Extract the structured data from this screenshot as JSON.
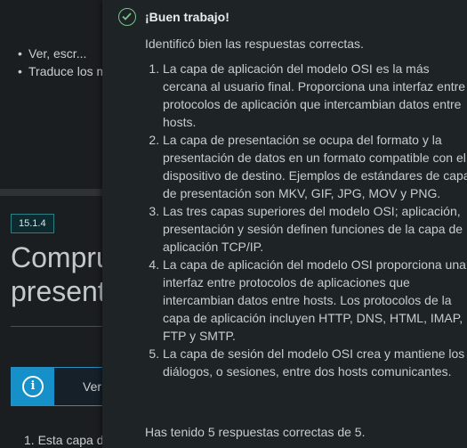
{
  "background": {
    "bullets": [
      "Ver, escr...",
      "Traduce los m"
    ],
    "section_badge": "15.1.4",
    "section_title_line1": "Compru",
    "section_title_line2": "present",
    "infobox_label": "Ver",
    "list_first_item": "1. Esta capa d"
  },
  "feedback": {
    "heading": "¡Buen trabajo!",
    "intro": "Identificó bien las respuestas correctas.",
    "answers": [
      "La capa de aplicación del modelo OSI es la más cercana al usuario final. Proporciona una interfaz entre protocolos de aplicación que intercambian datos entre hosts.",
      "La capa de presentación se ocupa del formato y la presentación de datos en un formato compatible con el dispositivo de destino. Ejemplos de estándares de capa de presentación son MKV, GIF, JPG, MOV y PNG.",
      "Las tres capas superiores del modelo OSI; aplicación, presentación y sesión definen funciones de la capa de aplicación TCP/IP.",
      "La capa de aplicación del modelo OSI proporciona una interfaz entre protocolos de aplicaciones que intercambian datos entre hosts. Los protocolos de la capa de aplicación incluyen HTTP, DNS, HTML, IMAP, FTP y SMTP.",
      "La capa de sesión del modelo OSI crea y mantiene los diálogos, o sesiones, entre dos hosts comunicantes."
    ],
    "score": "Has tenido 5 respuestas correctas de 5."
  },
  "colors": {
    "page_bg": "#1b1e20",
    "panel_bg": "#1e2326",
    "success_green": "#7cc38a",
    "info_blue": "#1690c8",
    "badge_teal": "#2d7f86"
  },
  "icons": {
    "success": "check-circle-icon",
    "info": "info-circle-icon"
  }
}
